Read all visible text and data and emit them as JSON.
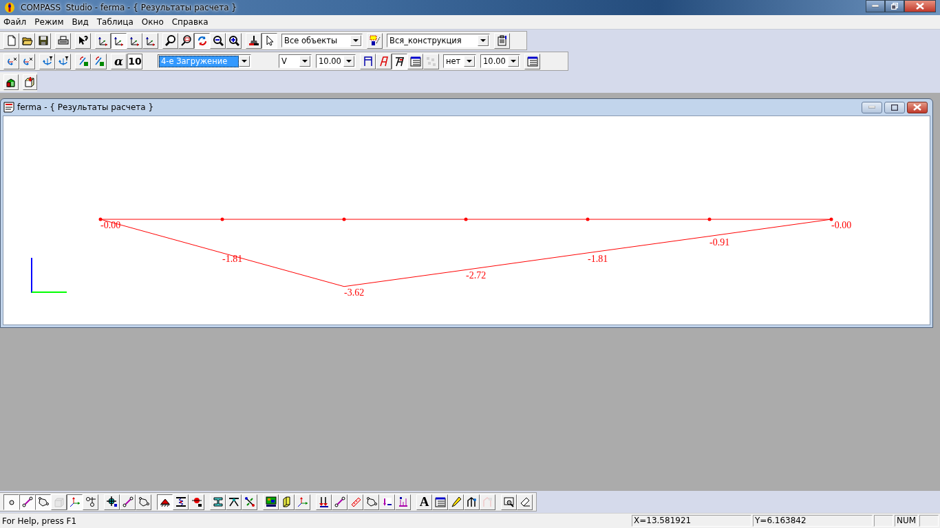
{
  "window": {
    "title": "COMPASS  Studio - ferma - { Результаты расчета }"
  },
  "menu": [
    {
      "label": "Файл"
    },
    {
      "label": "Режим"
    },
    {
      "label": "Вид"
    },
    {
      "label": "Таблица"
    },
    {
      "label": "Окно"
    },
    {
      "label": "Справка"
    }
  ],
  "toolbar_1": {
    "buttons": [
      {
        "pressed": false
      },
      {
        "pressed": false
      },
      {
        "pressed": false
      },
      {
        "pressed": false
      },
      {
        "pressed": false
      },
      {
        "pressed": false
      },
      {
        "pressed": true
      },
      {
        "pressed": false
      },
      {
        "pressed": false
      },
      {
        "pressed": false
      },
      {
        "pressed": false
      },
      {
        "pressed": true
      },
      {
        "pressed": false
      },
      {
        "pressed": false
      },
      {
        "pressed": false
      },
      {
        "pressed": true
      }
    ],
    "filter_combo": {
      "value": "Все объекты"
    },
    "select_button": {
      "pressed": false
    },
    "scope_combo": {
      "value": "Вся_конструкция"
    },
    "properties_button": {
      "pressed": false
    }
  },
  "toolbar_2": {
    "rotation_buttons": [
      {
        "pressed": false
      },
      {
        "pressed": false
      },
      {
        "pressed": false
      },
      {
        "pressed": false
      },
      {
        "pressed": false
      },
      {
        "pressed": false
      }
    ],
    "angle_button": {
      "label": "α"
    },
    "angle_field": {
      "value": "10"
    },
    "load_case_combo": {
      "value": "4-е Загружение",
      "focused": true
    },
    "component_combo": {
      "value": "V",
      "focused": false
    },
    "scale_combo": {
      "value": "10.00",
      "focused": false
    },
    "label_buttons": [
      {
        "pressed": false,
        "disabled": false
      },
      {
        "pressed": false,
        "disabled": false
      },
      {
        "pressed": true,
        "disabled": false
      },
      {
        "pressed": false,
        "disabled": false
      },
      {
        "pressed": false,
        "disabled": true
      }
    ],
    "units_combo": {
      "value": "нет",
      "focused": false
    },
    "precision_combo": {
      "value": "10.00",
      "focused": false
    },
    "table_button": {
      "pressed": false
    }
  },
  "toolbar_3": {
    "buttons": [
      {
        "pressed": false
      },
      {
        "pressed": false
      }
    ]
  },
  "document": {
    "title": "ferma - { Результаты расчета }",
    "nodes": [
      {
        "value": "-0.00"
      },
      {
        "value": "-1.81"
      },
      {
        "value": "-3.62"
      },
      {
        "value": "-2.72"
      },
      {
        "value": "-1.81"
      },
      {
        "value": "-0.91"
      },
      {
        "value": "-0.00"
      }
    ]
  },
  "bottom_toolbar": {
    "buttons": [
      {
        "pressed": true,
        "disabled": false
      },
      {
        "pressed": true,
        "disabled": false
      },
      {
        "pressed": true,
        "disabled": false
      },
      {
        "pressed": false,
        "disabled": true
      },
      {
        "pressed": true,
        "disabled": false
      },
      {
        "pressed": false,
        "disabled": false
      },
      {
        "pressed": false,
        "disabled": false
      },
      {
        "pressed": false,
        "disabled": false
      },
      {
        "pressed": false,
        "disabled": false
      },
      {
        "pressed": true,
        "disabled": false
      },
      {
        "pressed": false,
        "disabled": false
      },
      {
        "pressed": false,
        "disabled": false
      },
      {
        "pressed": false,
        "disabled": false
      },
      {
        "pressed": false,
        "disabled": false
      },
      {
        "pressed": false,
        "disabled": false
      },
      {
        "pressed": false,
        "disabled": false
      },
      {
        "pressed": false,
        "disabled": false
      },
      {
        "pressed": false,
        "disabled": false
      },
      {
        "pressed": false,
        "disabled": false
      },
      {
        "pressed": false,
        "disabled": false
      },
      {
        "pressed": false,
        "disabled": false
      },
      {
        "pressed": false,
        "disabled": false
      },
      {
        "pressed": false,
        "disabled": false
      },
      {
        "pressed": false,
        "disabled": false
      },
      {
        "label": "A",
        "pressed": false,
        "disabled": false
      },
      {
        "pressed": false,
        "disabled": false
      },
      {
        "pressed": false,
        "disabled": false
      },
      {
        "pressed": false,
        "disabled": false
      },
      {
        "pressed": false,
        "disabled": true
      },
      {
        "pressed": false,
        "disabled": false
      },
      {
        "pressed": false,
        "disabled": false
      }
    ]
  },
  "status_bar": {
    "help": "For Help, press F1",
    "x": "X=13.581921",
    "y": "Y=6.163842",
    "mode": "NUM"
  }
}
